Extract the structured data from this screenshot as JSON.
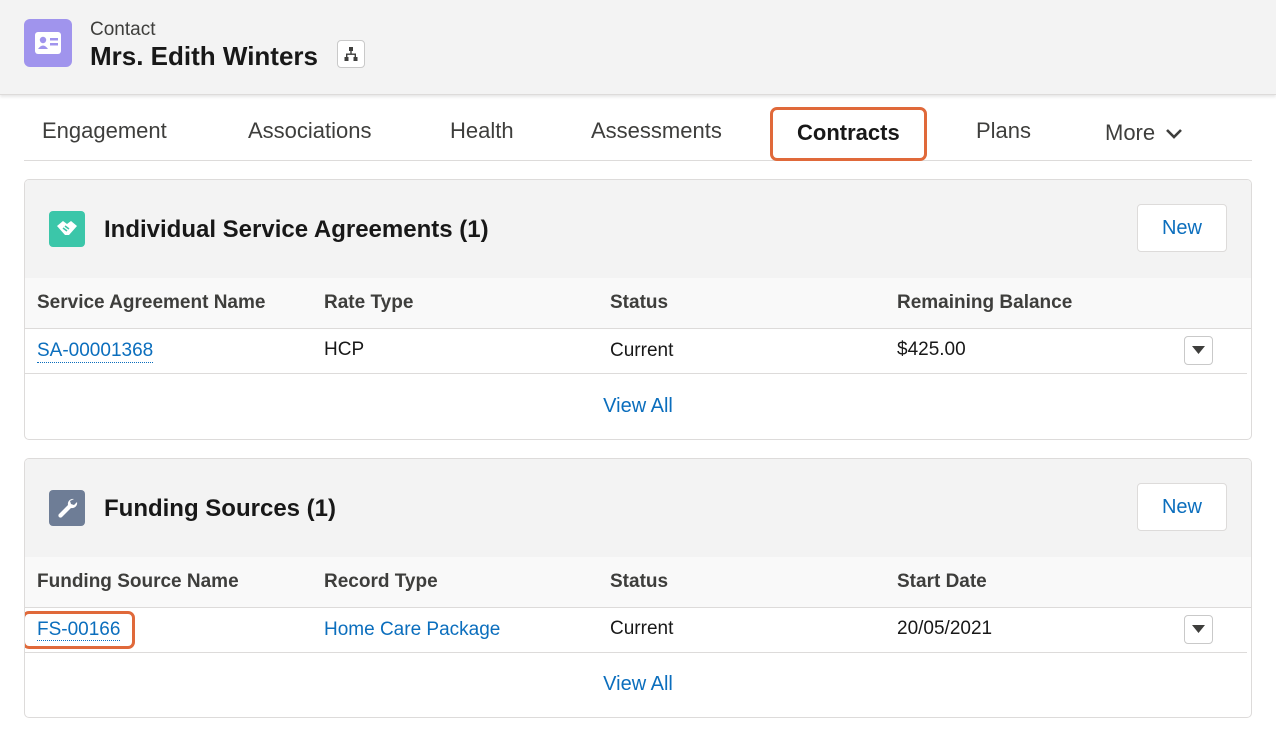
{
  "header": {
    "object_label": "Contact",
    "record_name": "Mrs. Edith Winters",
    "icon": "contact-card-icon",
    "icon_color": "#a094ed"
  },
  "tabs": [
    {
      "label": "Engagement"
    },
    {
      "label": "Associations"
    },
    {
      "label": "Health"
    },
    {
      "label": "Assessments"
    },
    {
      "label": "Contracts",
      "active": true
    },
    {
      "label": "Plans"
    },
    {
      "label": "More"
    }
  ],
  "agreements": {
    "title": "Individual Service Agreements (1)",
    "icon": "handshake-icon",
    "icon_color": "#3bc6a9",
    "new_label": "New",
    "columns": [
      "Service Agreement Name",
      "Rate Type",
      "Status",
      "Remaining Balance"
    ],
    "rows": [
      {
        "name": "SA-00001368",
        "rate_type": "HCP",
        "status": "Current",
        "balance": "$425.00"
      }
    ],
    "view_all": "View All"
  },
  "funding": {
    "title": "Funding Sources (1)",
    "icon": "wrench-icon",
    "icon_color": "#6e7d96",
    "new_label": "New",
    "columns": [
      "Funding Source Name",
      "Record Type",
      "Status",
      "Start Date"
    ],
    "rows": [
      {
        "name": "FS-00166",
        "record_type": "Home Care Package",
        "status": "Current",
        "start_date": "20/05/2021"
      }
    ],
    "view_all": "View All"
  },
  "colors": {
    "highlight": "#e0693a",
    "link": "#0b6ebd"
  }
}
